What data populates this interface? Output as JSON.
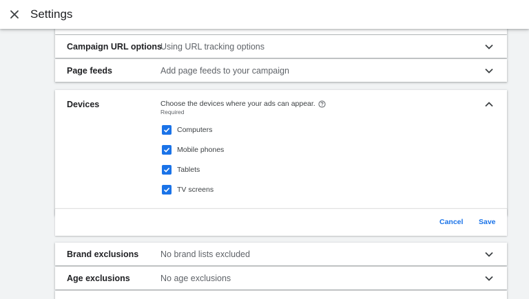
{
  "header": {
    "title": "Settings"
  },
  "rows": {
    "campaign_url": {
      "label": "Campaign URL options",
      "value": "Using URL tracking options"
    },
    "page_feeds": {
      "label": "Page feeds",
      "value": "Add page feeds to your campaign"
    },
    "brand_exclusions": {
      "label": "Brand exclusions",
      "value": "No brand lists excluded"
    },
    "age_exclusions": {
      "label": "Age exclusions",
      "value": "No age exclusions"
    }
  },
  "devices": {
    "label": "Devices",
    "description": "Choose the devices where your ads can appear.",
    "required": "Required",
    "options": [
      {
        "label": "Computers",
        "checked": true
      },
      {
        "label": "Mobile phones",
        "checked": true
      },
      {
        "label": "Tablets",
        "checked": true
      },
      {
        "label": "TV screens",
        "checked": true
      }
    ],
    "cancel_label": "Cancel",
    "save_label": "Save"
  },
  "colors": {
    "accent": "#1a73e8",
    "background": "#f1f3f4",
    "card": "#ffffff",
    "secondary_text": "#5f6368"
  },
  "icons": {
    "close": "close-icon",
    "expand": "chevron-down-icon",
    "collapse": "chevron-up-icon",
    "help": "help-circle-icon",
    "check": "check-icon"
  }
}
